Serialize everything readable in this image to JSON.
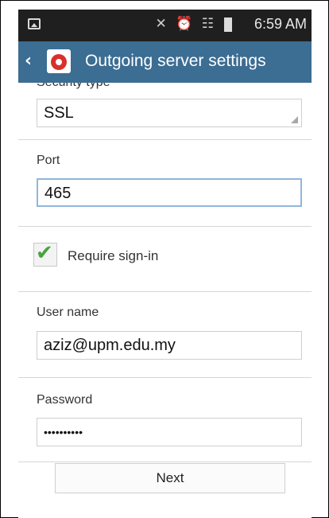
{
  "status_bar": {
    "time": "6:59 AM",
    "icons": "✕ ⏰ ☷"
  },
  "action_bar": {
    "title": "Outgoing server settings"
  },
  "security": {
    "label": "Security type",
    "value": "SSL"
  },
  "port": {
    "label": "Port",
    "value": "465"
  },
  "require_signin": {
    "label": "Require sign-in",
    "checked": true
  },
  "username": {
    "label": "User name",
    "value": "aziz@upm.edu.my"
  },
  "password": {
    "label": "Password",
    "value": "••••••••••"
  },
  "next_button": {
    "label": "Next"
  },
  "colors": {
    "action_bar": "#3c6d93",
    "status_bar": "#1f1f1f",
    "checkmark": "#4aa142"
  }
}
